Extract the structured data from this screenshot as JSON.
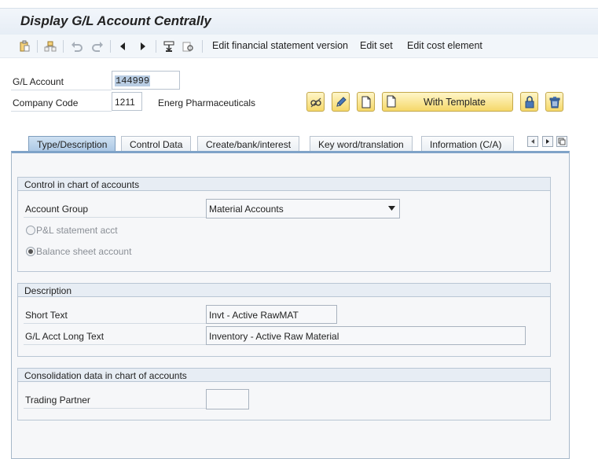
{
  "window": {
    "title": "Display G/L Account Centrally"
  },
  "toolbar": {
    "icons": [
      "clipboard-icon",
      "hierarchy-icon",
      "undo-icon",
      "redo-icon",
      "previous-icon",
      "next-icon",
      "print-icon",
      "find-icon"
    ],
    "edit_fs_version": "Edit financial statement version",
    "edit_set": "Edit set",
    "edit_cost_element": "Edit cost element"
  },
  "header": {
    "gl_account_label": "G/L Account",
    "gl_account_value": "144999",
    "company_code_label": "Company Code",
    "company_code_value": "1211",
    "company_name": "Energ Pharmaceuticals",
    "with_template_label": "With Template"
  },
  "tabs": [
    {
      "label": "Type/Description",
      "active": true
    },
    {
      "label": "Control Data",
      "active": false
    },
    {
      "label": "Create/bank/interest",
      "active": false
    },
    {
      "label": "Key word/translation",
      "active": false
    },
    {
      "label": "Information (C/A)",
      "active": false
    }
  ],
  "control_group": {
    "title": "Control in chart of accounts",
    "account_group_label": "Account Group",
    "account_group_value": "Material Accounts",
    "pl_label": "P&L statement acct",
    "bs_label": "Balance sheet account",
    "selected": "Balance sheet account"
  },
  "description_group": {
    "title": "Description",
    "short_text_label": "Short Text",
    "short_text_value": "Invt - Active RawMAT",
    "long_text_label": "G/L Acct Long Text",
    "long_text_value": "Inventory - Active Raw Material"
  },
  "consolidation_group": {
    "title": "Consolidation data in chart of accounts",
    "trading_partner_label": "Trading Partner",
    "trading_partner_value": ""
  },
  "colors": {
    "title_bar": "#e9eff6",
    "active_tab": "#b8d0ea",
    "gold_button": "#f5d86a",
    "pane_background": "#f6f7f9"
  }
}
